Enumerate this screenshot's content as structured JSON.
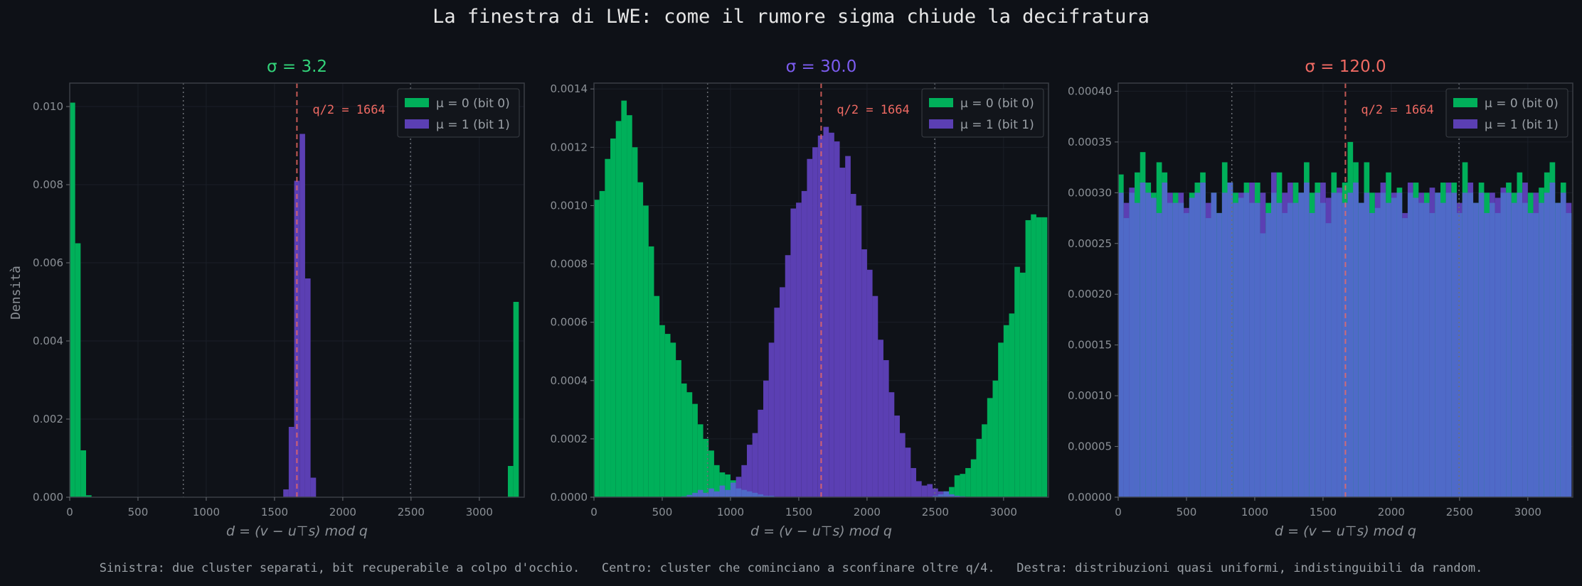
{
  "figure": {
    "title": "La finestra di LWE: come il rumore sigma chiude la decifratura",
    "caption": "Sinistra: due cluster separati, bit recuperabile a colpo d'occhio.   Centro: cluster che cominciano a sconfinare oltre q/4.   Destra: distribuzioni quasi uniformi, indistinguibili da random.",
    "ylabel": "Densità",
    "colors": {
      "background": "#0e1117",
      "bit0": "#00b05a",
      "bit1": "#5b3fb3",
      "overlap": "#4f6ac8",
      "halfq": "#f06a63"
    }
  },
  "chart_data": [
    {
      "type": "histogram",
      "title": "σ = 3.2",
      "title_color": "#33d47a",
      "xlabel": "d = (v − u⊤s) mod q",
      "xlim": [
        0,
        3329
      ],
      "ylim": [
        0,
        0.0106
      ],
      "xticks": [
        0,
        500,
        1000,
        1500,
        2000,
        2500,
        3000
      ],
      "yticks": [
        "0.000",
        "0.002",
        "0.004",
        "0.006",
        "0.008",
        "0.010"
      ],
      "yticks_values": [
        0,
        0.002,
        0.004,
        0.006,
        0.008,
        0.01
      ],
      "vlines_dotted": [
        832,
        2496
      ],
      "vline_half_q": 1664,
      "annotation": "q/2 = 1664",
      "legend": [
        "μ = 0 (bit 0)",
        "μ = 1 (bit 1)"
      ],
      "bin_width": 40,
      "series": [
        {
          "name": "μ = 0 (bit 0)",
          "color": "#00b05a",
          "bins": [
            [
              0,
              0.0101
            ],
            [
              40,
              0.0065
            ],
            [
              80,
              0.0012
            ],
            [
              120,
              5e-05
            ],
            [
              3209,
              0.0008
            ],
            [
              3249,
              0.005
            ]
          ]
        },
        {
          "name": "μ = 1 (bit 1)",
          "color": "#5b3fb3",
          "bins": [
            [
              1564,
              0.0002
            ],
            [
              1604,
              0.0018
            ],
            [
              1644,
              0.0081
            ],
            [
              1684,
              0.0093
            ],
            [
              1724,
              0.0056
            ],
            [
              1764,
              0.0005
            ]
          ]
        }
      ]
    },
    {
      "type": "histogram",
      "title": "σ = 30.0",
      "title_color": "#7c5cf0",
      "xlabel": "d = (v − u⊤s) mod q",
      "xlim": [
        0,
        3329
      ],
      "ylim": [
        0,
        0.00142
      ],
      "xticks": [
        0,
        500,
        1000,
        1500,
        2000,
        2500,
        3000
      ],
      "yticks": [
        "0.0000",
        "0.0002",
        "0.0004",
        "0.0006",
        "0.0008",
        "0.0010",
        "0.0012",
        "0.0014"
      ],
      "yticks_values": [
        0,
        0.0002,
        0.0004,
        0.0006,
        0.0008,
        0.001,
        0.0012,
        0.0014
      ],
      "vlines_dotted": [
        832,
        2496
      ],
      "vline_half_q": 1664,
      "annotation": "q/2 = 1664",
      "legend": [
        "μ = 0 (bit 0)",
        "μ = 1 (bit 1)"
      ],
      "bin_width": 40,
      "series": [
        {
          "name": "μ = 0 (bit 0)",
          "color": "#00b05a",
          "values": [
            0.00102,
            0.00105,
            0.00116,
            0.00123,
            0.00129,
            0.00136,
            0.00131,
            0.0012,
            0.00108,
            0.001,
            0.00086,
            0.00069,
            0.00059,
            0.00056,
            0.00053,
            0.00047,
            0.00039,
            0.00036,
            0.00032,
            0.00025,
            0.0002,
            0.00016,
            0.00011,
            8.5e-05,
            7.8e-05,
            5.8e-05,
            3e-05,
            2.5e-05,
            2e-05,
            1.5e-05,
            1e-05,
            5e-06,
            5e-06,
            0.0,
            0.0,
            0.0,
            0.0,
            0.0,
            0.0,
            0.0,
            0.0,
            0.0,
            0.0,
            0.0,
            0.0,
            0.0,
            0.0,
            0.0,
            0.0,
            0.0,
            0.0,
            0.0,
            0.0,
            0.0,
            0.0,
            0.0,
            0.0,
            0.0,
            0.0,
            0.0,
            0.0,
            0.0,
            5e-06,
            1e-05,
            2e-05,
            3.5e-05,
            7.5e-05,
            8e-05,
            0.0001,
            0.00013,
            0.0002,
            0.00025,
            0.00034,
            0.0004,
            0.00053,
            0.00059,
            0.00063,
            0.00079,
            0.00077,
            0.00095,
            0.00097,
            0.00096,
            0.00096
          ]
        },
        {
          "name": "μ = 1 (bit 1)",
          "color": "#5b3fb3",
          "values": [
            0,
            0,
            0,
            0,
            0,
            0,
            0,
            0,
            0,
            0,
            0,
            0,
            0,
            0,
            0,
            0,
            3e-06,
            8e-06,
            1.5e-05,
            2.5e-05,
            1.5e-05,
            3e-05,
            2e-05,
            4e-05,
            2.5e-05,
            5e-05,
            7e-05,
            0.00011,
            0.00018,
            0.00022,
            0.0003,
            0.0004,
            0.00053,
            0.00065,
            0.00072,
            0.00083,
            0.00099,
            0.00101,
            0.00105,
            0.00116,
            0.0012,
            0.00124,
            0.00127,
            0.00125,
            0.00122,
            0.00113,
            0.00117,
            0.00104,
            0.001,
            0.00085,
            0.00078,
            0.00069,
            0.00054,
            0.00047,
            0.00036,
            0.00028,
            0.00022,
            0.00017,
            0.0001,
            5.5e-05,
            4e-05,
            4.5e-05,
            3e-05,
            2e-05,
            2e-05,
            1e-05,
            5e-06,
            3e-06,
            0,
            0,
            0,
            0,
            0,
            0,
            0,
            0,
            0,
            0,
            0,
            0,
            0,
            0,
            0
          ]
        }
      ]
    },
    {
      "type": "histogram",
      "title": "σ = 120.0",
      "title_color": "#f06a63",
      "xlabel": "d = (v − u⊤s) mod q",
      "xlim": [
        0,
        3329
      ],
      "ylim": [
        0,
        0.000408
      ],
      "xticks": [
        0,
        500,
        1000,
        1500,
        2000,
        2500,
        3000
      ],
      "yticks": [
        "0.00000",
        "0.00005",
        "0.00010",
        "0.00015",
        "0.00020",
        "0.00025",
        "0.00030",
        "0.00035",
        "0.00040"
      ],
      "yticks_values": [
        0,
        5e-05,
        0.0001,
        0.00015,
        0.0002,
        0.00025,
        0.0003,
        0.00035,
        0.0004
      ],
      "vlines_dotted": [
        832,
        2496
      ],
      "vline_half_q": 1664,
      "annotation": "q/2 = 1664",
      "legend": [
        "μ = 0 (bit 0)",
        "μ = 1 (bit 1)"
      ],
      "bin_width": 40,
      "series": [
        {
          "name": "μ = 0 (bit 0)",
          "color": "#00b05a",
          "values": [
            0.000318,
            0.000275,
            0.0003,
            0.00032,
            0.00034,
            0.00031,
            0.0003,
            0.00033,
            0.00032,
            0.00029,
            0.0003,
            0.00029,
            0.00028,
            0.0003,
            0.00031,
            0.00032,
            0.000275,
            0.0003,
            0.00028,
            0.00033,
            0.00031,
            0.0003,
            0.000295,
            0.00031,
            0.00029,
            0.00031,
            0.00026,
            0.00029,
            0.0003,
            0.00032,
            0.00028,
            0.00029,
            0.00031,
            0.0003,
            0.00033,
            0.0003,
            0.00031,
            0.00029,
            0.00027,
            0.00032,
            0.0003,
            0.00031,
            0.00035,
            0.00033,
            0.00029,
            0.00033,
            0.0003,
            0.000285,
            0.0003,
            0.00032,
            0.000295,
            0.000305,
            0.000275,
            0.0003,
            0.00031,
            0.00029,
            0.0003,
            0.00028,
            0.0003,
            0.00031,
            0.0003,
            0.00031,
            0.00028,
            0.00033,
            0.0003,
            0.00029,
            0.00031,
            0.0003,
            0.00029,
            0.00028,
            0.0003,
            0.00031,
            0.0003,
            0.00032,
            0.00029,
            0.0003,
            0.00028,
            0.000305,
            0.00032,
            0.00033,
            0.00029,
            0.00031,
            0.00028
          ]
        },
        {
          "name": "μ = 1 (bit 1)",
          "color": "#5b3fb3",
          "values": [
            0.0003,
            0.00029,
            0.000305,
            0.00029,
            0.00031,
            0.0003,
            0.000295,
            0.00028,
            0.00031,
            0.0003,
            0.00029,
            0.0003,
            0.000285,
            0.000295,
            0.0003,
            0.00031,
            0.00029,
            0.0003,
            0.00028,
            0.0003,
            0.00031,
            0.00029,
            0.0003,
            0.0003,
            0.00031,
            0.00029,
            0.0003,
            0.00028,
            0.00032,
            0.00029,
            0.0003,
            0.00031,
            0.00029,
            0.0003,
            0.00031,
            0.00028,
            0.0003,
            0.00031,
            0.000295,
            0.0003,
            0.000305,
            0.00029,
            0.0003,
            0.00031,
            0.00029,
            0.0003,
            0.00028,
            0.0003,
            0.00031,
            0.00029,
            0.0003,
            0.0003,
            0.00028,
            0.00031,
            0.000295,
            0.0003,
            0.00029,
            0.000305,
            0.0003,
            0.00029,
            0.00031,
            0.0003,
            0.00029,
            0.0003,
            0.00031,
            0.00029,
            0.0003,
            0.00028,
            0.0003,
            0.000295,
            0.000305,
            0.0003,
            0.00029,
            0.0003,
            0.00031,
            0.00028,
            0.0003,
            0.00029,
            0.0003,
            0.00031,
            0.00029,
            0.0003,
            0.00029
          ]
        }
      ]
    }
  ]
}
